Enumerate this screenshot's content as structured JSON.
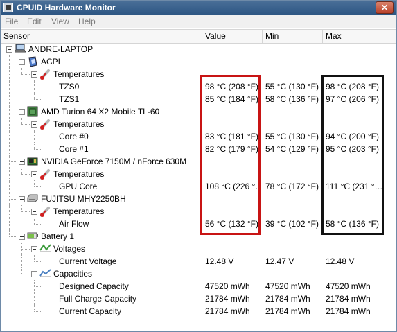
{
  "window": {
    "title": "CPUID Hardware Monitor",
    "close_symbol": "✕"
  },
  "menu": [
    "File",
    "Edit",
    "View",
    "Help"
  ],
  "columns": {
    "sensor": "Sensor",
    "value": "Value",
    "min": "Min",
    "max": "Max"
  },
  "rows": [
    {
      "label": "ANDRE-LAPTOP",
      "value": "",
      "min": "",
      "max": "",
      "icon": "laptop-icon"
    },
    {
      "label": "ACPI",
      "value": "",
      "min": "",
      "max": "",
      "icon": "acpi-icon"
    },
    {
      "label": "Temperatures",
      "value": "",
      "min": "",
      "max": "",
      "icon": "thermometer-icon"
    },
    {
      "label": "TZS0",
      "value": "98 °C  (208 °F)",
      "min": "55 °C  (130 °F)",
      "max": "98 °C  (208 °F)",
      "icon": ""
    },
    {
      "label": "TZS1",
      "value": "85 °C  (184 °F)",
      "min": "58 °C  (136 °F)",
      "max": "97 °C  (206 °F)",
      "icon": ""
    },
    {
      "label": "AMD Turion 64 X2 Mobile TL-60",
      "value": "",
      "min": "",
      "max": "",
      "icon": "cpu-icon"
    },
    {
      "label": "Temperatures",
      "value": "",
      "min": "",
      "max": "",
      "icon": "thermometer-icon"
    },
    {
      "label": "Core #0",
      "value": "83 °C  (181 °F)",
      "min": "55 °C  (130 °F)",
      "max": "94 °C  (200 °F)",
      "icon": ""
    },
    {
      "label": "Core #1",
      "value": "82 °C  (179 °F)",
      "min": "54 °C  (129 °F)",
      "max": "95 °C  (203 °F)",
      "icon": ""
    },
    {
      "label": "NVIDIA GeForce 7150M / nForce 630M",
      "value": "",
      "min": "",
      "max": "",
      "icon": "gpu-icon"
    },
    {
      "label": "Temperatures",
      "value": "",
      "min": "",
      "max": "",
      "icon": "thermometer-icon"
    },
    {
      "label": "GPU Core",
      "value": "108 °C  (226 °…",
      "min": "78 °C  (172 °F)",
      "max": "111 °C  (231 °…",
      "icon": ""
    },
    {
      "label": "FUJITSU MHY2250BH",
      "value": "",
      "min": "",
      "max": "",
      "icon": "hard-drive-icon"
    },
    {
      "label": "Temperatures",
      "value": "",
      "min": "",
      "max": "",
      "icon": "thermometer-icon"
    },
    {
      "label": "Air Flow",
      "value": "56 °C  (132 °F)",
      "min": "39 °C  (102 °F)",
      "max": "58 °C  (136 °F)",
      "icon": ""
    },
    {
      "label": "Battery 1",
      "value": "",
      "min": "",
      "max": "",
      "icon": "battery-icon"
    },
    {
      "label": "Voltages",
      "value": "",
      "min": "",
      "max": "",
      "icon": "voltage-icon"
    },
    {
      "label": "Current Voltage",
      "value": "12.48 V",
      "min": "12.47 V",
      "max": "12.48 V",
      "icon": ""
    },
    {
      "label": "Capacities",
      "value": "",
      "min": "",
      "max": "",
      "icon": "capacity-icon"
    },
    {
      "label": "Designed Capacity",
      "value": "47520 mWh",
      "min": "47520 mWh",
      "max": "47520 mWh",
      "icon": ""
    },
    {
      "label": "Full Charge Capacity",
      "value": "21784 mWh",
      "min": "21784 mWh",
      "max": "21784 mWh",
      "icon": ""
    },
    {
      "label": "Current Capacity",
      "value": "21784 mWh",
      "min": "21784 mWh",
      "max": "21784 mWh",
      "icon": ""
    }
  ],
  "highlight_colors": {
    "value_box": "#c81414",
    "max_box": "#111111"
  }
}
